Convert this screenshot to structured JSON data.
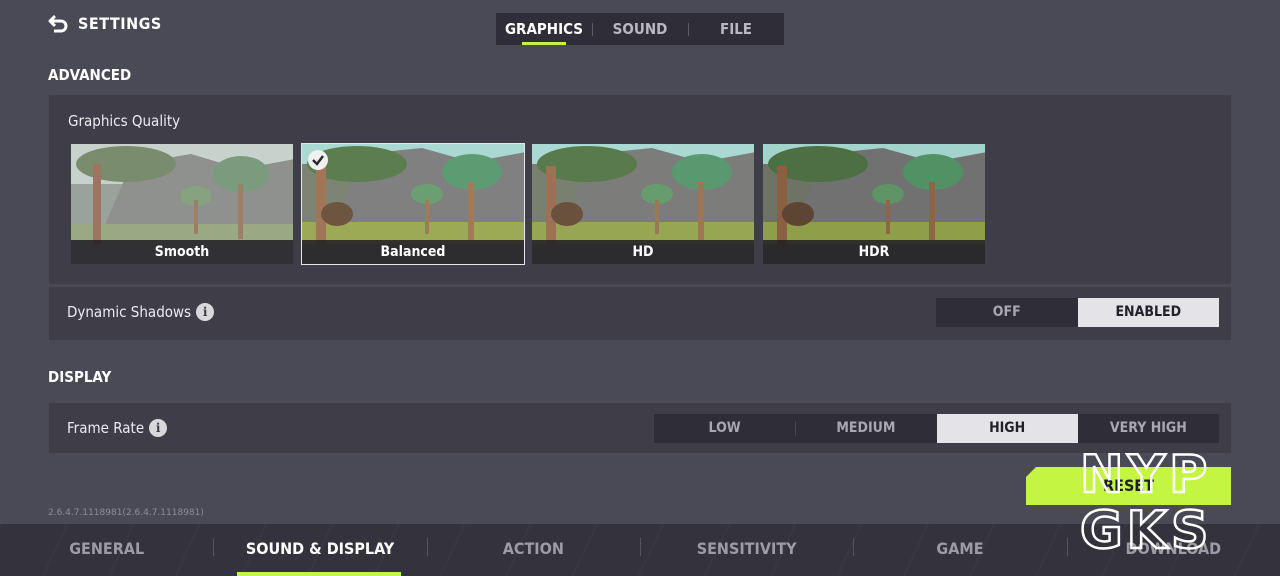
{
  "header": {
    "title": "SETTINGS"
  },
  "top_tabs": [
    "GRAPHICS",
    "SOUND",
    "FILE"
  ],
  "advanced": {
    "title": "ADVANCED",
    "graphics_quality": {
      "label": "Graphics Quality",
      "options": [
        "Smooth",
        "Balanced",
        "HD",
        "HDR"
      ],
      "selected": "Balanced"
    },
    "dynamic_shadows": {
      "label": "Dynamic Shadows",
      "options": [
        "OFF",
        "ENABLED"
      ],
      "selected": "ENABLED"
    }
  },
  "display": {
    "title": "DISPLAY",
    "frame_rate": {
      "label": "Frame Rate",
      "options": [
        "LOW",
        "MEDIUM",
        "HIGH",
        "VERY HIGH"
      ],
      "selected": "HIGH"
    }
  },
  "reset_label": "RESET",
  "version": "2.6.4.7.1118981(2.6.4.7.1118981)",
  "bottom_nav": [
    "GENERAL",
    "SOUND & DISPLAY",
    "ACTION",
    "SENSITIVITY",
    "GAME",
    "DOWNLOAD"
  ],
  "watermark": [
    "NYP",
    "GKS"
  ],
  "colors": {
    "accent": "#c4f542",
    "background": "#4a4956",
    "panel": "#3e3d48"
  },
  "icons": {
    "back": "back-arrow-icon",
    "info": "info-icon",
    "check": "check-icon"
  }
}
